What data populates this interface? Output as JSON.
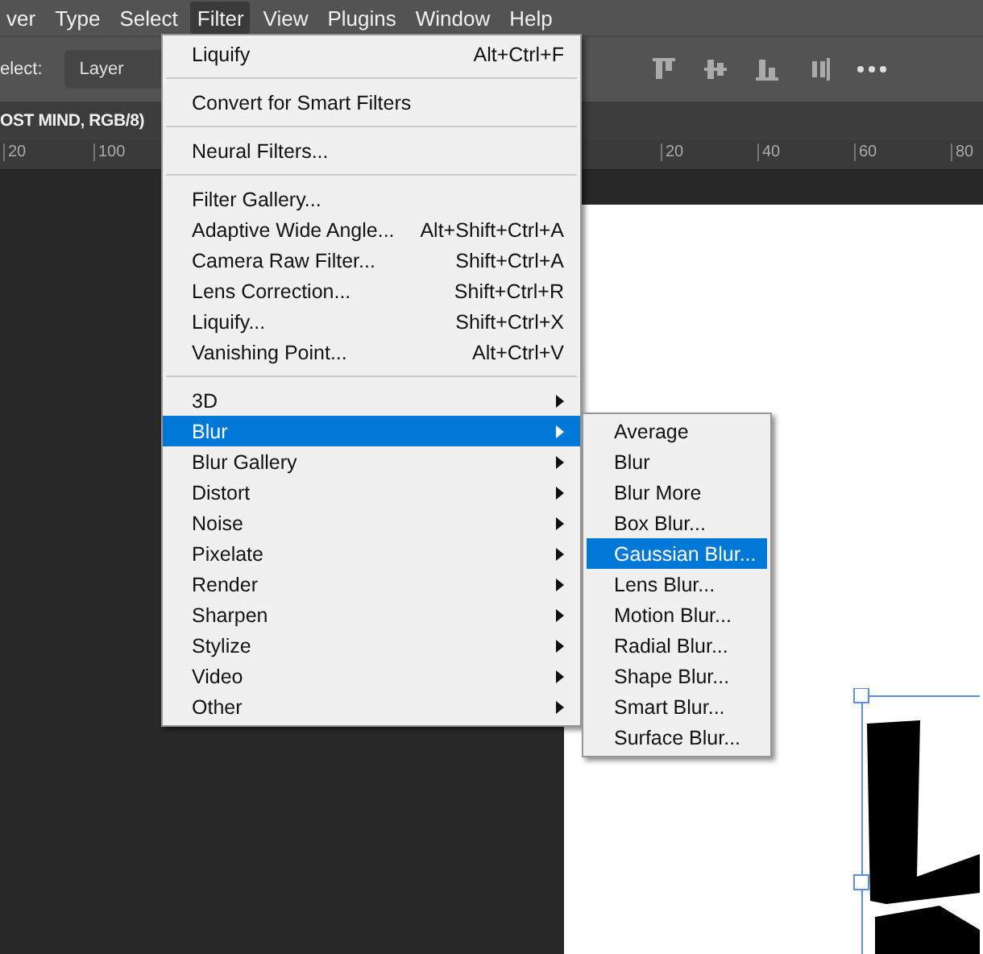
{
  "menubar": [
    {
      "label": "ver",
      "selected": false
    },
    {
      "label": "Type",
      "selected": false
    },
    {
      "label": "Select",
      "selected": false
    },
    {
      "label": "Filter",
      "selected": true
    },
    {
      "label": "View",
      "selected": false
    },
    {
      "label": "Plugins",
      "selected": false
    },
    {
      "label": "Window",
      "selected": false
    },
    {
      "label": "Help",
      "selected": false
    }
  ],
  "options_bar": {
    "label": "elect:",
    "dropdown": "Layer"
  },
  "document_tab": {
    "title": "OST MIND, RGB/8)"
  },
  "ruler": [
    "20",
    "100",
    "20",
    "40",
    "60",
    "80"
  ],
  "filter_menu": {
    "items": [
      {
        "kind": "item",
        "label": "Liquify",
        "shortcut": "Alt+Ctrl+F",
        "submenu": false,
        "selected": false
      },
      {
        "kind": "separator"
      },
      {
        "kind": "item",
        "label": "Convert for Smart Filters",
        "submenu": false,
        "selected": false
      },
      {
        "kind": "separator"
      },
      {
        "kind": "item",
        "label": "Neural Filters...",
        "submenu": false,
        "selected": false
      },
      {
        "kind": "separator"
      },
      {
        "kind": "item",
        "label": "Filter Gallery...",
        "submenu": false,
        "selected": false
      },
      {
        "kind": "item",
        "label": "Adaptive Wide Angle...",
        "shortcut": "Alt+Shift+Ctrl+A",
        "submenu": false,
        "selected": false
      },
      {
        "kind": "item",
        "label": "Camera Raw Filter...",
        "shortcut": "Shift+Ctrl+A",
        "submenu": false,
        "selected": false
      },
      {
        "kind": "item",
        "label": "Lens Correction...",
        "shortcut": "Shift+Ctrl+R",
        "submenu": false,
        "selected": false
      },
      {
        "kind": "item",
        "label": "Liquify...",
        "shortcut": "Shift+Ctrl+X",
        "submenu": false,
        "selected": false
      },
      {
        "kind": "item",
        "label": "Vanishing Point...",
        "shortcut": "Alt+Ctrl+V",
        "submenu": false,
        "selected": false
      },
      {
        "kind": "separator"
      },
      {
        "kind": "item",
        "label": "3D",
        "submenu": true,
        "selected": false
      },
      {
        "kind": "item",
        "label": "Blur",
        "submenu": true,
        "selected": true
      },
      {
        "kind": "item",
        "label": "Blur Gallery",
        "submenu": true,
        "selected": false
      },
      {
        "kind": "item",
        "label": "Distort",
        "submenu": true,
        "selected": false
      },
      {
        "kind": "item",
        "label": "Noise",
        "submenu": true,
        "selected": false
      },
      {
        "kind": "item",
        "label": "Pixelate",
        "submenu": true,
        "selected": false
      },
      {
        "kind": "item",
        "label": "Render",
        "submenu": true,
        "selected": false
      },
      {
        "kind": "item",
        "label": "Sharpen",
        "submenu": true,
        "selected": false
      },
      {
        "kind": "item",
        "label": "Stylize",
        "submenu": true,
        "selected": false
      },
      {
        "kind": "item",
        "label": "Video",
        "submenu": true,
        "selected": false
      },
      {
        "kind": "item",
        "label": "Other",
        "submenu": true,
        "selected": false
      }
    ]
  },
  "blur_submenu": {
    "items": [
      {
        "label": "Average",
        "selected": false
      },
      {
        "label": "Blur",
        "selected": false
      },
      {
        "label": "Blur More",
        "selected": false
      },
      {
        "label": "Box Blur...",
        "selected": false
      },
      {
        "label": "Gaussian Blur...",
        "selected": true
      },
      {
        "label": "Lens Blur...",
        "selected": false
      },
      {
        "label": "Motion Blur...",
        "selected": false
      },
      {
        "label": "Radial Blur...",
        "selected": false
      },
      {
        "label": "Shape Blur...",
        "selected": false
      },
      {
        "label": "Smart Blur...",
        "selected": false
      },
      {
        "label": "Surface Blur...",
        "selected": false
      }
    ]
  }
}
